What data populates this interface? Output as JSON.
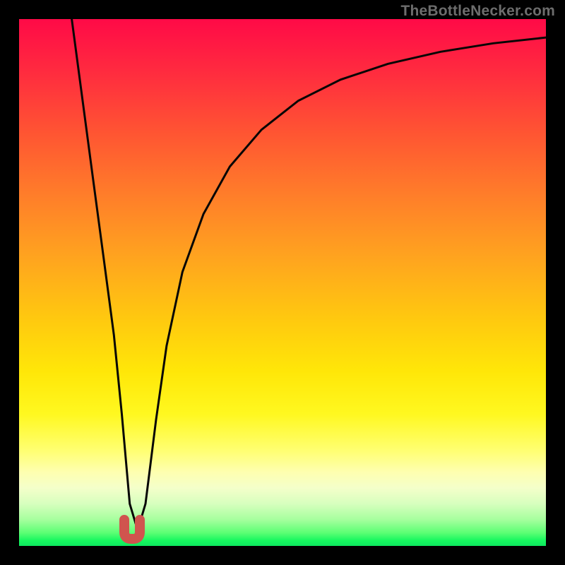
{
  "attribution": "TheBottleNecker.com",
  "chart_data": {
    "type": "line",
    "title": "",
    "xlabel": "",
    "ylabel": "",
    "xlim": [
      0,
      100
    ],
    "ylim": [
      0,
      100
    ],
    "series": [
      {
        "name": "bottleneck-curve",
        "x": [
          10,
          12,
          14,
          16,
          18,
          19.5,
          21,
          22.5,
          24,
          26,
          28,
          31,
          35,
          40,
          46,
          53,
          61,
          70,
          80,
          90,
          100
        ],
        "y": [
          100,
          85,
          70,
          55,
          40,
          25,
          8,
          3,
          8,
          24,
          38,
          52,
          63,
          72,
          79,
          84.5,
          88.5,
          91.5,
          93.8,
          95.4,
          96.5
        ]
      }
    ],
    "marker": {
      "note": "red U-shaped marker at curve minimum",
      "x_center": 21.4,
      "y_center": 2.4,
      "color": "#d0544e"
    },
    "colors": {
      "curve": "#060605",
      "marker": "#d0544e",
      "gradient_top": "#ff0a47",
      "gradient_bottom": "#0ee85f"
    }
  }
}
